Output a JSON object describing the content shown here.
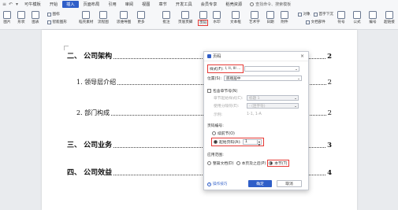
{
  "menubar": {
    "items": [
      "开始",
      "插入",
      "页面布局",
      "引用",
      "审阅",
      "视图",
      "章节",
      "开发工具",
      "会员专享",
      "稻壳资源"
    ],
    "first_label": "可牛模板",
    "active_index": 1,
    "search_text": "查找命令、搜索模板"
  },
  "ribbon": {
    "picture": "图片",
    "shape": "形状",
    "chart": "图表",
    "icon_lib": "图标",
    "smart_graph": "智能图形",
    "stock": "稻壳素材",
    "flowchart": "流程图",
    "mindmap": "思维导图",
    "more": "更多",
    "comment": "批注",
    "header_footer": "页眉页脚",
    "page_number": "页码",
    "watermark": "水印",
    "textbox": "文本框",
    "wordart": "艺术字",
    "date": "日期",
    "attachment": "附件",
    "object": "对象",
    "first_drop": "首字下沉",
    "doc_parts": "文档部件",
    "symbol": "符号",
    "formula": "公式",
    "number": "编号",
    "hyperlink": "超链接"
  },
  "document": {
    "lines": [
      {
        "text": "二、  公司架构",
        "page": "2"
      },
      {
        "text": "1.    领导层介绍",
        "page": "2"
      },
      {
        "text": "2.    部门构成",
        "page": "2"
      },
      {
        "text": "三、  公司业务",
        "page": "3"
      },
      {
        "text": "四、  公司效益",
        "page": "4"
      }
    ]
  },
  "dialog": {
    "title": "页码",
    "style_label": "样式(F):",
    "style_value": "I, II, III ...",
    "position_label": "位置(S):",
    "position_value": "底端居中",
    "include_chapter": "包含章节号(N)",
    "chapter_start_label": "章节起始样式(C):",
    "chapter_start_value": "标题 1",
    "separator_label": "使用分隔符(E):",
    "separator_value": "- (连字符)",
    "example_label": "示例:",
    "example_value": "1-1, 1-A",
    "numbering_heading": "页码编号:",
    "continue_prev": "续前节(O)",
    "start_page_label": "起始页码(A):",
    "start_page_value": "1",
    "apply_heading": "应用范围:",
    "apply_whole": "整篇文档(D)",
    "apply_after": "本页及之后(P)",
    "apply_section": "本节(T)",
    "tip": "操作技巧",
    "ok": "确定",
    "cancel": "取消"
  }
}
